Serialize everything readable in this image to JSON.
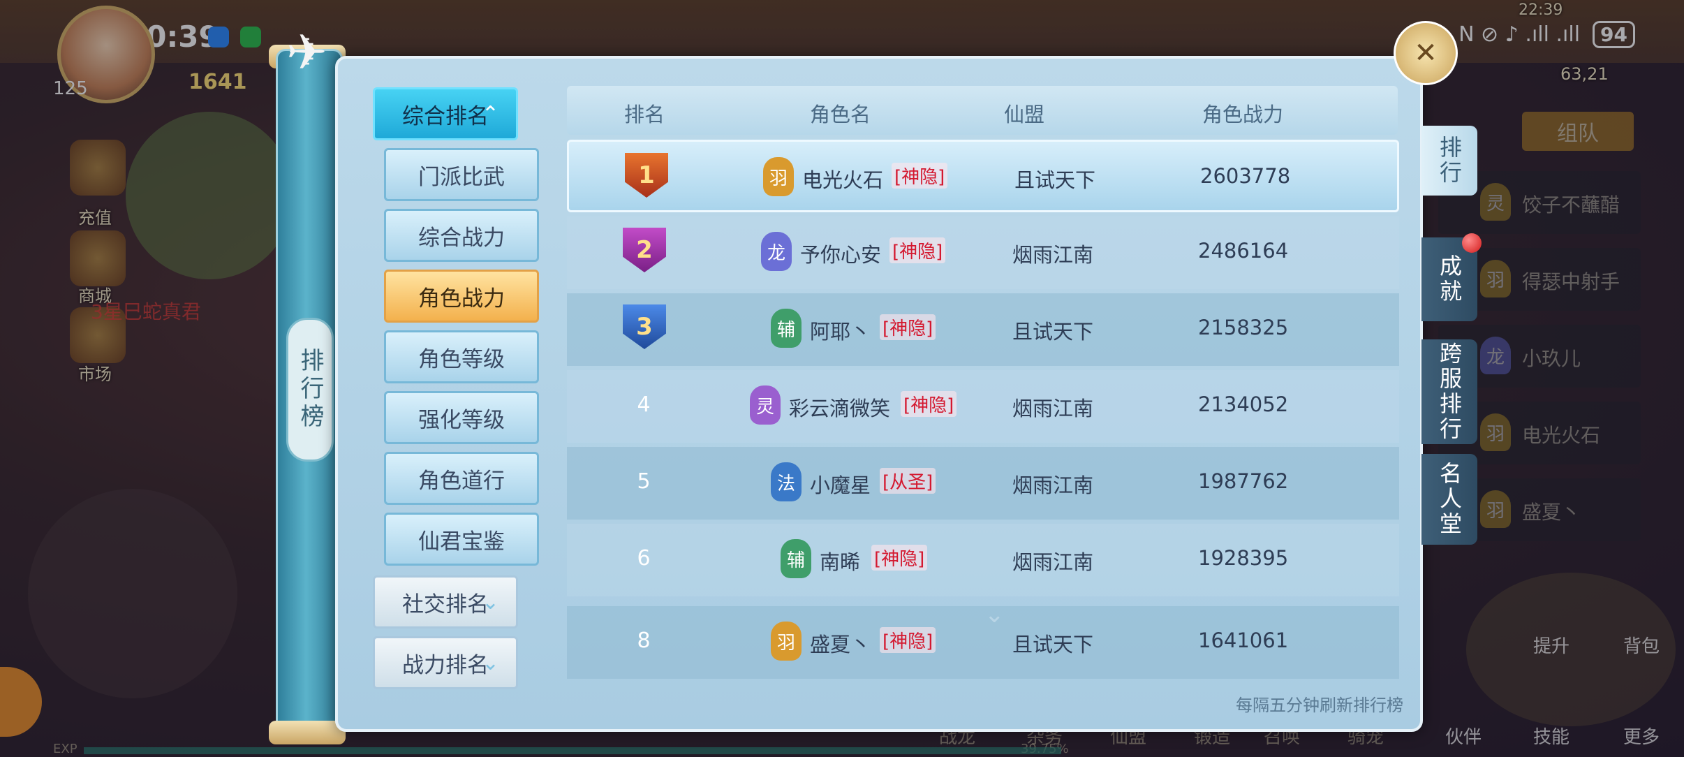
{
  "status_bar": {
    "time": "10:39",
    "battery": "94",
    "signal_text": "N ⊘ ♪ .ıll .ıll"
  },
  "hud": {
    "player_level": "125",
    "power": "1641",
    "top_right_time": "22:39",
    "coords": "63,21",
    "team_label": "组队",
    "left_icons": [
      "充值",
      "商城",
      "市场"
    ],
    "left_red_text": "3星巳蛇真君",
    "bottom_items": [
      "战龙",
      "杂务",
      "仙盟",
      "锻造",
      "召唤",
      "骑宠",
      "伙伴",
      "技能",
      "更多"
    ],
    "right_icons": [
      "提升",
      "背包"
    ],
    "exp_label": "EXP",
    "exp_percent": "39.75%"
  },
  "side_list": [
    {
      "badge": "灵",
      "name": "饺子不蘸醋"
    },
    {
      "badge": "羽",
      "name": "得瑟中射手"
    },
    {
      "badge": "龙",
      "name": "小玖儿"
    },
    {
      "badge": "羽",
      "name": "电光火石"
    },
    {
      "badge": "羽",
      "name": "盛夏丶"
    }
  ],
  "panel": {
    "title": "排行榜",
    "refresh_note": "每隔五分钟刷新排行榜",
    "categories": {
      "main_active": "综合排名",
      "sub_items": [
        "门派比武",
        "综合战力",
        "角色战力",
        "角色等级",
        "强化等级",
        "角色道行",
        "仙君宝鉴"
      ],
      "selected_sub": "角色战力",
      "social": "社交排名",
      "combat": "战力排名"
    },
    "table": {
      "headers": [
        "排名",
        "角色名",
        "仙盟",
        "角色战力"
      ],
      "rows": [
        {
          "rank": "1",
          "school": "羽",
          "name": "电光火石",
          "tag": "[神隐]",
          "guild": "且试天下",
          "power": "2603778"
        },
        {
          "rank": "2",
          "school": "龙",
          "name": "予你心安",
          "tag": "[神隐]",
          "guild": "烟雨江南",
          "power": "2486164"
        },
        {
          "rank": "3",
          "school": "辅",
          "name": "阿耶丶",
          "tag": "[神隐]",
          "guild": "且试天下",
          "power": "2158325"
        },
        {
          "rank": "4",
          "school": "灵",
          "name": "彩云滴微笑",
          "tag": "[神隐]",
          "guild": "烟雨江南",
          "power": "2134052"
        },
        {
          "rank": "5",
          "school": "法",
          "name": "小魔星",
          "tag": "[从圣]",
          "guild": "烟雨江南",
          "power": "1987762"
        },
        {
          "rank": "6",
          "school": "辅",
          "name": "南晞",
          "tag": "[神隐]",
          "guild": "烟雨江南",
          "power": "1928395"
        }
      ],
      "self_row": {
        "rank": "8",
        "school": "羽",
        "name": "盛夏丶",
        "tag": "[神隐]",
        "guild": "且试天下",
        "power": "1641061"
      }
    }
  },
  "right_tabs": [
    "排行",
    "成就",
    "跨服排行",
    "名人堂"
  ],
  "colors": {
    "panel_bg": "#bcd9ea",
    "active_category": "#1fa9d8",
    "selected_sub": "#f3b14d",
    "tag_red": "#d4182f",
    "school_feather": "#d99a2e",
    "school_dragon": "#6b6fd6",
    "school_aux": "#3f9e6a",
    "school_spirit": "#9a5fcf",
    "school_magic": "#3a79c8"
  }
}
